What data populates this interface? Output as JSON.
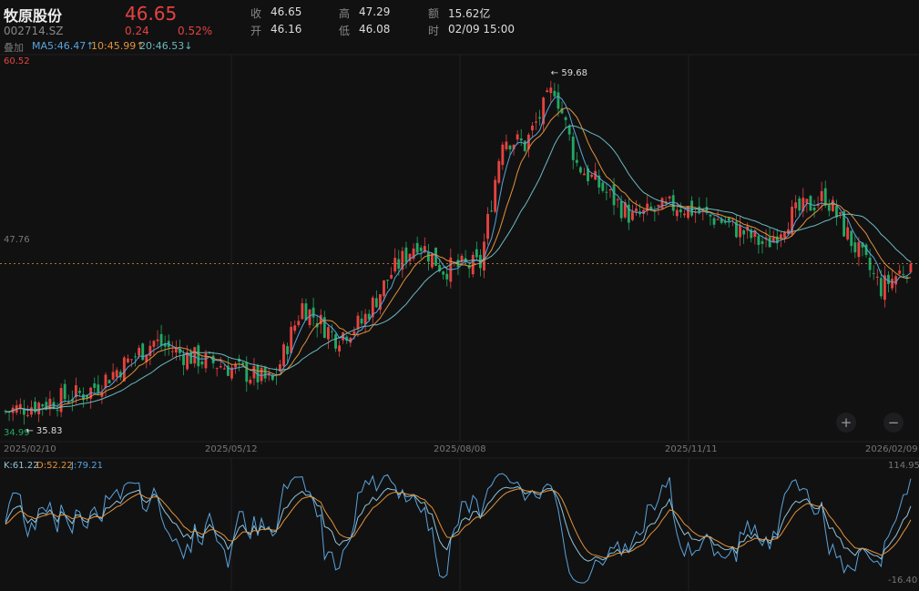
{
  "header": {
    "name": "牧原股份",
    "code": "002714.SZ",
    "price": "46.65",
    "change": "0.24",
    "change_pct": "0.52%",
    "close_label": "收",
    "close": "46.65",
    "high_label": "高",
    "high": "47.29",
    "amount_label": "额",
    "amount": "15.62亿",
    "open_label": "开",
    "open": "46.16",
    "low_label": "低",
    "low": "46.08",
    "time_label": "时",
    "time": "02/09 15:00"
  },
  "overlay": {
    "label": "叠加",
    "ma5": "MA5:46.47↑",
    "ma10": "10:45.99↑",
    "ma20": "20:46.53↓"
  },
  "colors": {
    "up": "#e5433f",
    "down": "#22a862",
    "ma5": "#5aa4dc",
    "ma10": "#e3923a",
    "ma20": "#6bb9bf",
    "k": "#8fc3d8",
    "d": "#e3923a",
    "j": "#5aa4dc"
  },
  "main": {
    "top_price": "60.52",
    "mid_price": "47.76",
    "bottom_price": "34.99",
    "max_marker": "← 59.68",
    "min_marker": "← 35.83",
    "zoom_in": "+",
    "zoom_out": "−"
  },
  "dates": [
    "2025/02/10",
    "2025/05/12",
    "2025/08/08",
    "2025/11/11",
    "2026/02/09"
  ],
  "kdj": {
    "k": "K:61.22",
    "d": "D:52.22",
    "j": "J:79.21",
    "top": "114.95",
    "bottom": "-16.40"
  },
  "chart_data": {
    "type": "candlestick",
    "days": 245,
    "ylim": [
      34.99,
      60.52
    ],
    "kdj_ylim": [
      -16.4,
      114.95
    ],
    "last_close": 46.65,
    "anchors": [
      [
        0,
        36.5
      ],
      [
        22,
        37.8
      ],
      [
        40,
        41.3
      ],
      [
        48,
        40.4
      ],
      [
        62,
        39.4
      ],
      [
        72,
        38.5
      ],
      [
        80,
        43.8
      ],
      [
        89,
        41.6
      ],
      [
        96,
        42.6
      ],
      [
        104,
        46
      ],
      [
        111,
        48.2
      ],
      [
        118,
        46.3
      ],
      [
        128,
        46.6
      ],
      [
        134,
        55.4
      ],
      [
        140,
        54.8
      ],
      [
        148,
        58.8
      ],
      [
        154,
        53.5
      ],
      [
        169,
        49.8
      ],
      [
        181,
        50.7
      ],
      [
        194,
        49.5
      ],
      [
        205,
        47.9
      ],
      [
        211,
        49.8
      ],
      [
        221,
        51.3
      ],
      [
        228,
        48.2
      ],
      [
        236,
        45
      ],
      [
        244,
        46.65
      ]
    ]
  }
}
